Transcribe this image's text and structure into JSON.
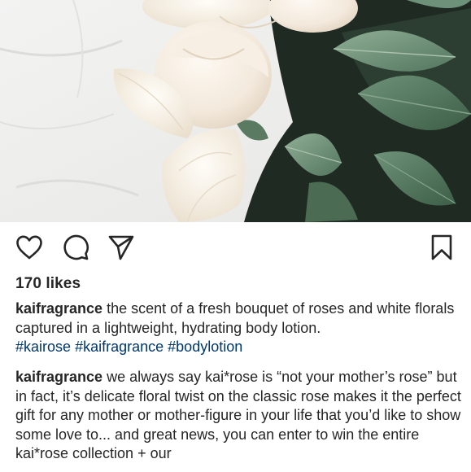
{
  "post": {
    "image_alt": "White roses with green leaves on a white linen cloth",
    "likes": "170 likes",
    "caption_1": {
      "username": "kaifragrance",
      "text": " the scent of a fresh bouquet of roses and white florals captured in a lightweight, hydrating body lotion.",
      "hashtags": [
        "#kairose",
        "#kaifragrance",
        "#bodylotion"
      ]
    },
    "caption_2": {
      "username": "kaifragrance",
      "text": " we always say kai*rose is “not your mother’s rose” but in fact, it’s delicate floral twist on the classic rose makes it the perfect gift for any mother or mother-figure in your life that you’d like to show some love to... and great news, you can enter to win the entire kai*rose collection + our"
    }
  },
  "icons": {
    "like": "heart-icon",
    "comment": "comment-bubble-icon",
    "share": "paper-plane-icon",
    "save": "bookmark-icon"
  },
  "colors": {
    "text": "#262626",
    "hashtag": "#00376b",
    "background": "#ffffff"
  }
}
